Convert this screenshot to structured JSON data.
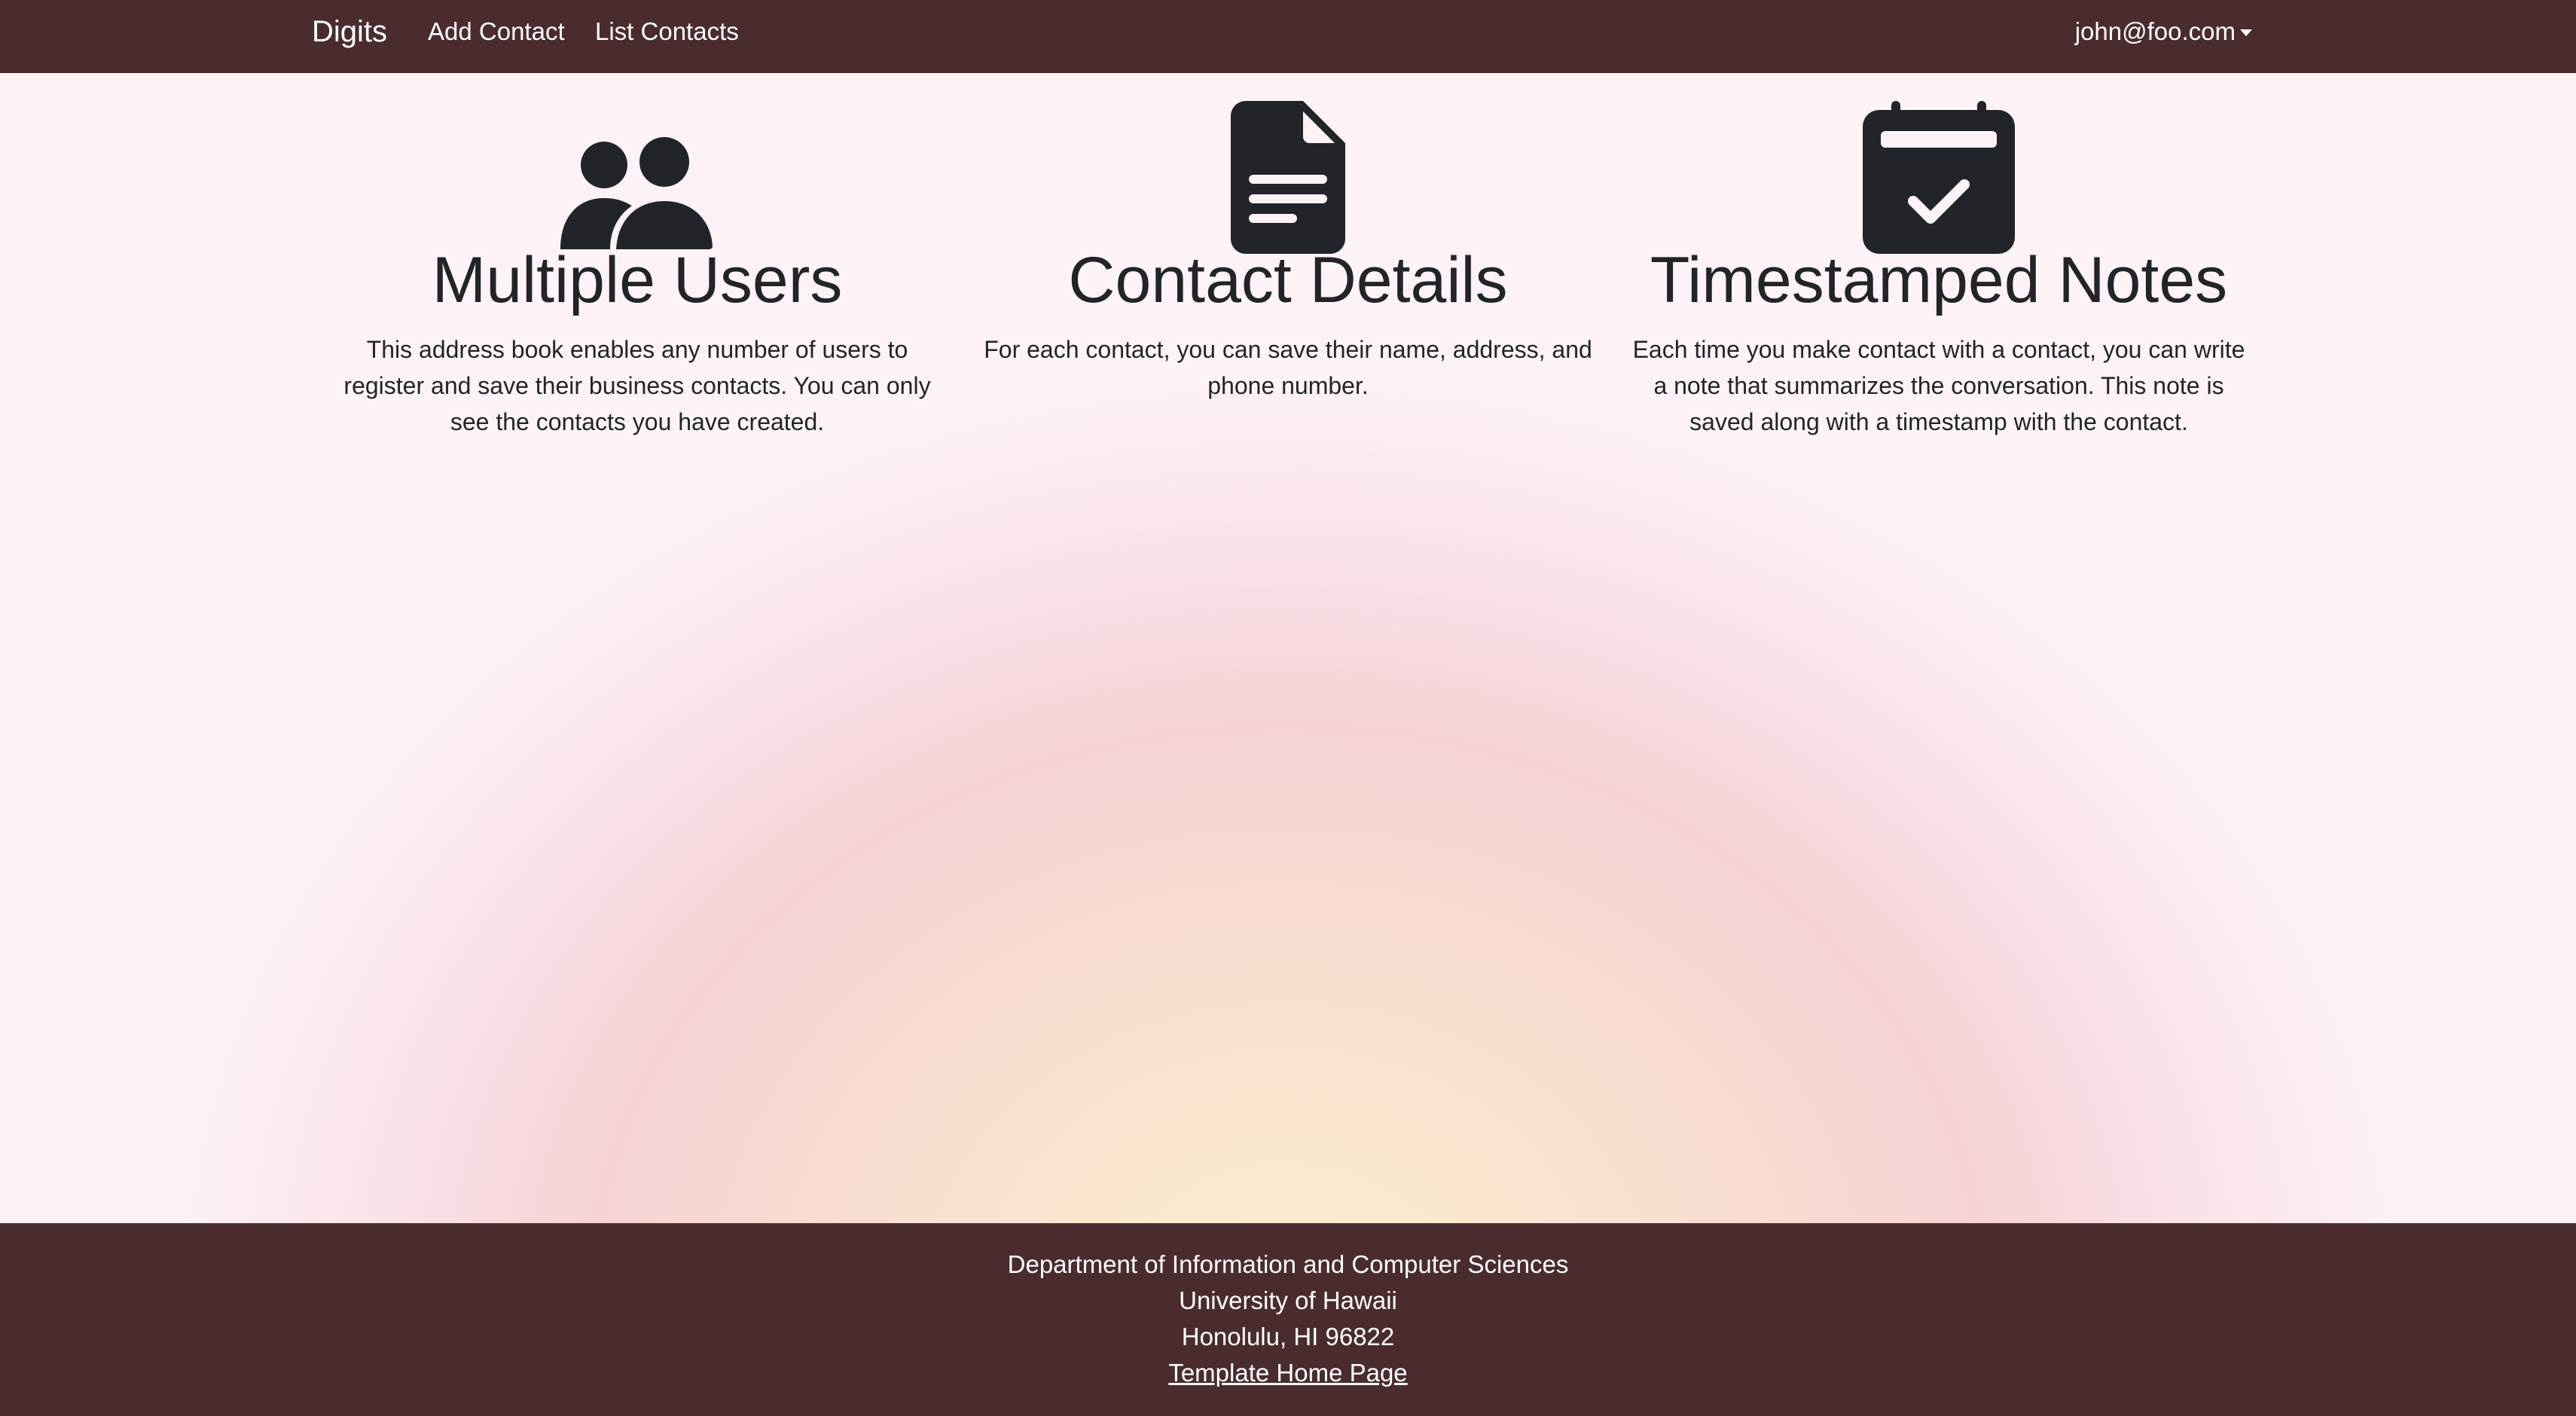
{
  "navbar": {
    "brand": "Digits",
    "links": [
      {
        "label": "Add Contact"
      },
      {
        "label": "List Contacts"
      }
    ],
    "user": "john@foo.com"
  },
  "features": [
    {
      "icon": "users-icon",
      "title": "Multiple Users",
      "text": "This address book enables any number of users to register and save their business contacts. You can only see the contacts you have created."
    },
    {
      "icon": "file-text-icon",
      "title": "Contact Details",
      "text": "For each contact, you can save their name, address, and phone number."
    },
    {
      "icon": "calendar-check-icon",
      "title": "Timestamped Notes",
      "text": "Each time you make contact with a contact, you can write a note that summarizes the conversation. This note is saved along with a timestamp with the contact."
    }
  ],
  "footer": {
    "line1": "Department of Information and Computer Sciences",
    "line2": "University of Hawaii",
    "line3": "Honolulu, HI 96822",
    "link": "Template Home Page"
  },
  "colors": {
    "navbar_bg": "#4a2c2f",
    "footer_bg": "#4a2c2f",
    "icon_color": "#212529",
    "text_color": "#212529"
  }
}
